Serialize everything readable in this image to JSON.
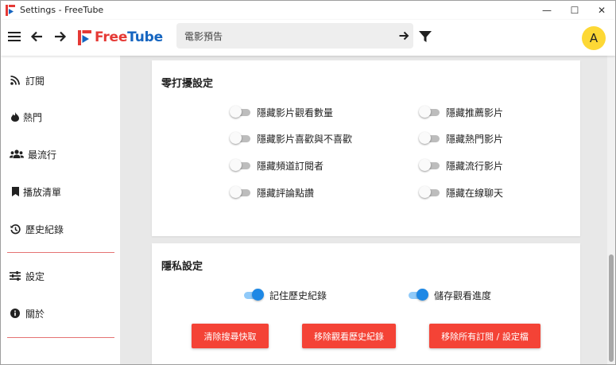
{
  "window": {
    "title": "Settings - FreeTube",
    "controls": {
      "minimize": "—",
      "maximize": "☐",
      "close": "✕"
    }
  },
  "topnav": {
    "logo_free": "Free",
    "logo_tube": "Tube",
    "search_value": "電影預告",
    "avatar_letter": "A",
    "colors": {
      "logo_red": "#e53935",
      "logo_blue": "#1565c0",
      "avatar_bg": "#fdd835"
    }
  },
  "sidebar": {
    "items": [
      {
        "label": "訂閱",
        "icon": "rss-icon"
      },
      {
        "label": "熱門",
        "icon": "fire-icon"
      },
      {
        "label": "最流行",
        "icon": "users-icon"
      },
      {
        "label": "播放清單",
        "icon": "bookmark-icon"
      },
      {
        "label": "歷史紀錄",
        "icon": "history-icon"
      },
      {
        "label": "設定",
        "icon": "sliders-icon"
      },
      {
        "label": "關於",
        "icon": "info-icon"
      }
    ]
  },
  "distraction_free": {
    "title": "零打擾設定",
    "left_toggles": [
      {
        "label": "隱藏影片觀看數量",
        "on": false
      },
      {
        "label": "隱藏影片喜歡與不喜歡",
        "on": false
      },
      {
        "label": "隱藏頻道訂閱者",
        "on": false
      },
      {
        "label": "隱藏評論點讚",
        "on": false
      }
    ],
    "right_toggles": [
      {
        "label": "隱藏推薦影片",
        "on": false
      },
      {
        "label": "隱藏熱門影片",
        "on": false
      },
      {
        "label": "隱藏流行影片",
        "on": false
      },
      {
        "label": "隱藏在線聊天",
        "on": false
      }
    ]
  },
  "privacy": {
    "title": "隱私設定",
    "toggles": [
      {
        "label": "記住歷史紀錄",
        "on": true
      },
      {
        "label": "儲存觀看進度",
        "on": true
      }
    ],
    "buttons": {
      "clear_search_cache": "清除搜尋快取",
      "remove_watch_history": "移除觀看歷史紀錄",
      "remove_all_subscriptions": "移除所有訂閱 / 設定檔"
    },
    "colors": {
      "button_red": "#f44336",
      "toggle_on": "#1e88e5"
    }
  }
}
